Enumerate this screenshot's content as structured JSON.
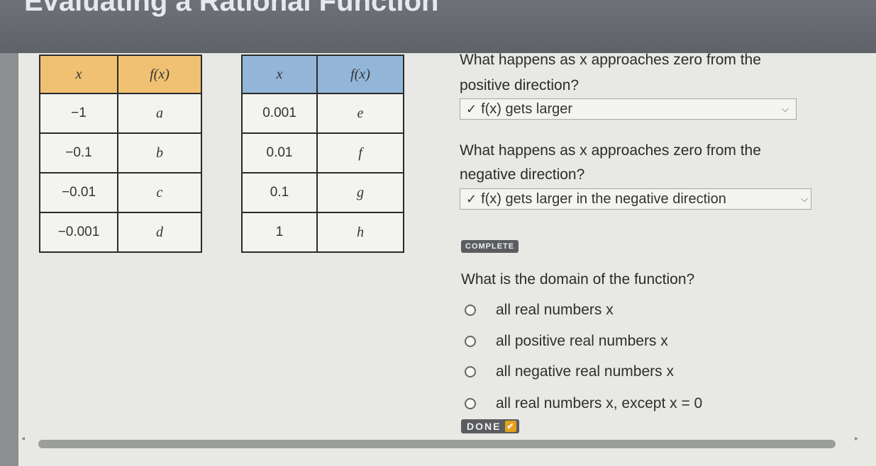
{
  "header": {
    "title": "Evaluating a Rational Function"
  },
  "table_negative": {
    "headers": [
      "x",
      "f(x)"
    ],
    "rows": [
      {
        "x": "−1",
        "f": "a"
      },
      {
        "x": "−0.1",
        "f": "b"
      },
      {
        "x": "−0.01",
        "f": "c"
      },
      {
        "x": "−0.001",
        "f": "d"
      }
    ]
  },
  "table_positive": {
    "headers": [
      "x",
      "f(x)"
    ],
    "rows": [
      {
        "x": "0.001",
        "f": "e"
      },
      {
        "x": "0.01",
        "f": "f"
      },
      {
        "x": "0.1",
        "f": "g"
      },
      {
        "x": "1",
        "f": "h"
      }
    ]
  },
  "question1": {
    "line1": "What happens as x approaches zero from the",
    "line2": "positive direction?",
    "answer": "f(x) gets larger"
  },
  "question2": {
    "line1": "What happens as x approaches zero from the",
    "line2": "negative direction?",
    "answer": "f(x) gets larger in the negative direction"
  },
  "complete_badge": "COMPLETE",
  "question3": {
    "text": "What is the domain of the function?",
    "options": [
      "all real numbers x",
      "all positive real numbers x",
      "all negative real numbers x",
      "all real numbers x, except x = 0"
    ]
  },
  "done_button": "DONE",
  "colors": {
    "table1_header": "#f0c172",
    "table2_header": "#93b6d8",
    "content_bg": "#e8e8e5",
    "header_bg": "#6e7178"
  }
}
